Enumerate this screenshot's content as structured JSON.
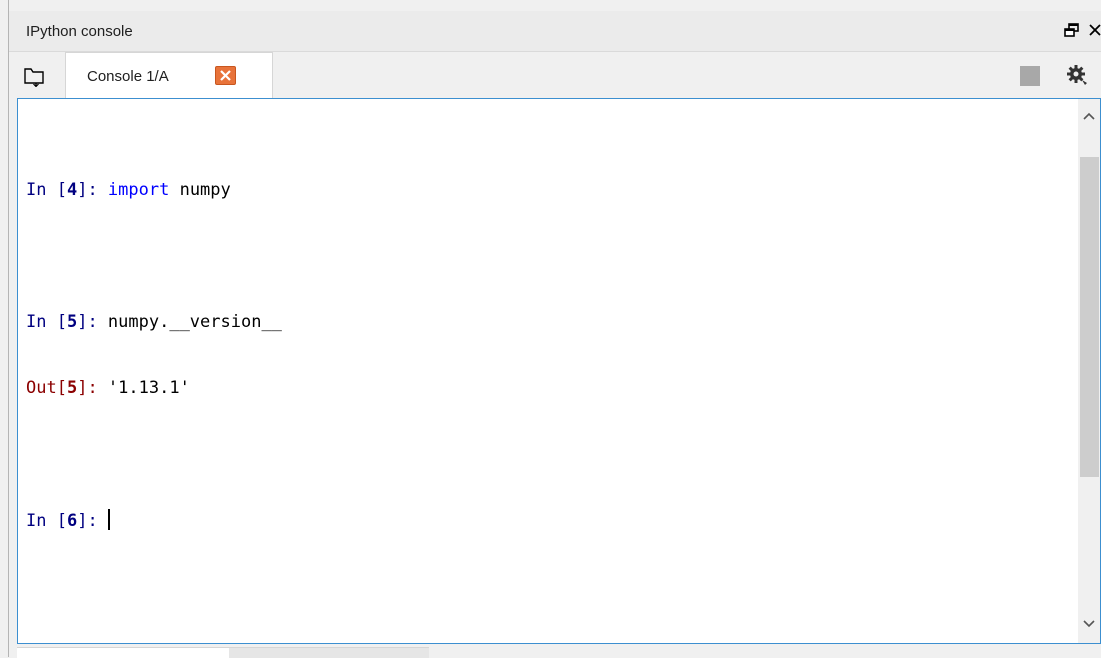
{
  "pane": {
    "title": "IPython console",
    "undock_icon": "undock-icon",
    "close_icon": "close-icon"
  },
  "tabs": [
    {
      "label": "Console 1/A",
      "close_icon": "tab-close-icon"
    }
  ],
  "toolbar": {
    "browse_icon": "browse-tabs-icon",
    "stop_icon": "stop-icon",
    "options_icon": "gear-icon"
  },
  "console": {
    "lines": [
      {
        "prompt_open": "In [",
        "num": "4",
        "prompt_close": "]: ",
        "keyword": "import",
        "rest": " numpy"
      },
      {
        "prompt_open": "In [",
        "num": "5",
        "prompt_close": "]: ",
        "code": "numpy.__version__"
      },
      {
        "prompt_open": "Out[",
        "num": "5",
        "prompt_close": "]: ",
        "value": "'1.13.1'"
      },
      {
        "prompt_open": "In [",
        "num": "6",
        "prompt_close": "]: ",
        "code": ""
      }
    ]
  },
  "colors": {
    "prompt_in": "#000080",
    "prompt_out": "#8b0000",
    "keyword": "#0000ff",
    "focus_border": "#3c8fd0",
    "tab_close": "#e8733a"
  }
}
